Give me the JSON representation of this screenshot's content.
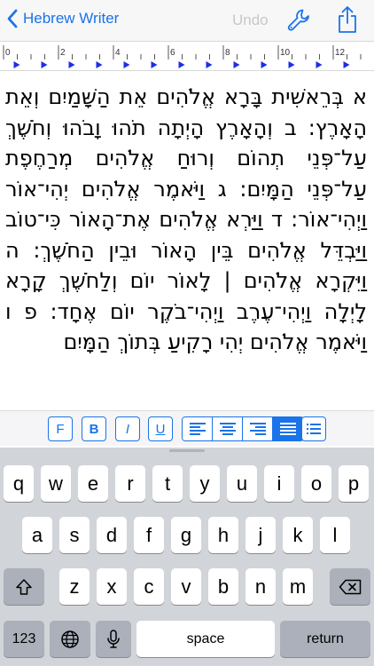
{
  "nav": {
    "back_label": "Hebrew Writer",
    "undo_label": "Undo"
  },
  "ruler": {
    "marks": [
      "0",
      "2",
      "4",
      "6",
      "8",
      "10",
      "12"
    ]
  },
  "editor": {
    "text": "א בְּרֵאשִׁית בָּרָא אֱלֹהִים אֵת הַשָּׁמַיִם וְאֵת הָאָרֶץ: ב וְהָאָרֶץ הָיְתָה תֹהוּ וָבֹהוּ וְחֹשֶׁךְ עַל־פְּנֵי תְהוֹם וְרוּחַ אֱלֹהִים מְרַחֶפֶת עַל־פְּנֵי הַמָּיִם: ג וַיֹּאמֶר אֱלֹהִים יְהִי־אוֹר וַיְהִי־אוֹר: ד וַיַּרְא אֱלֹהִים אֶת־הָאוֹר כִּי־טוֹב וַיַּבְדֵּל אֱלֹהִים בֵּין הָאוֹר וּבֵין הַחֹשֶׁךְ: ה וַיִּקְרָא אֱלֹהִים | לָאוֹר יוֹם וְלַחֹשֶׁךְ קָרָא לָיְלָה וַיְהִי־עֶרֶב וַיְהִי־בֹקֶר יוֹם אֶחָד: פ ו וַיֹּאמֶר אֱלֹהִים יְהִי רָקִיעַ בְּתוֹךְ הַמָּיִם"
  },
  "format": {
    "font_label": "F",
    "bold_label": "B",
    "italic_label": "I",
    "underline_label": "U",
    "alignment_selected": "justify"
  },
  "keyboard": {
    "row1": [
      "q",
      "w",
      "e",
      "r",
      "t",
      "y",
      "u",
      "i",
      "o",
      "p"
    ],
    "row2": [
      "a",
      "s",
      "d",
      "f",
      "g",
      "h",
      "j",
      "k",
      "l"
    ],
    "row3": [
      "z",
      "x",
      "c",
      "v",
      "b",
      "n",
      "m"
    ],
    "numbers_label": "123",
    "space_label": "space",
    "return_label": "return"
  },
  "colors": {
    "accent": "#1a73e8",
    "keyboard_bg": "#d1d4d9",
    "key_dark": "#abb0ba"
  }
}
